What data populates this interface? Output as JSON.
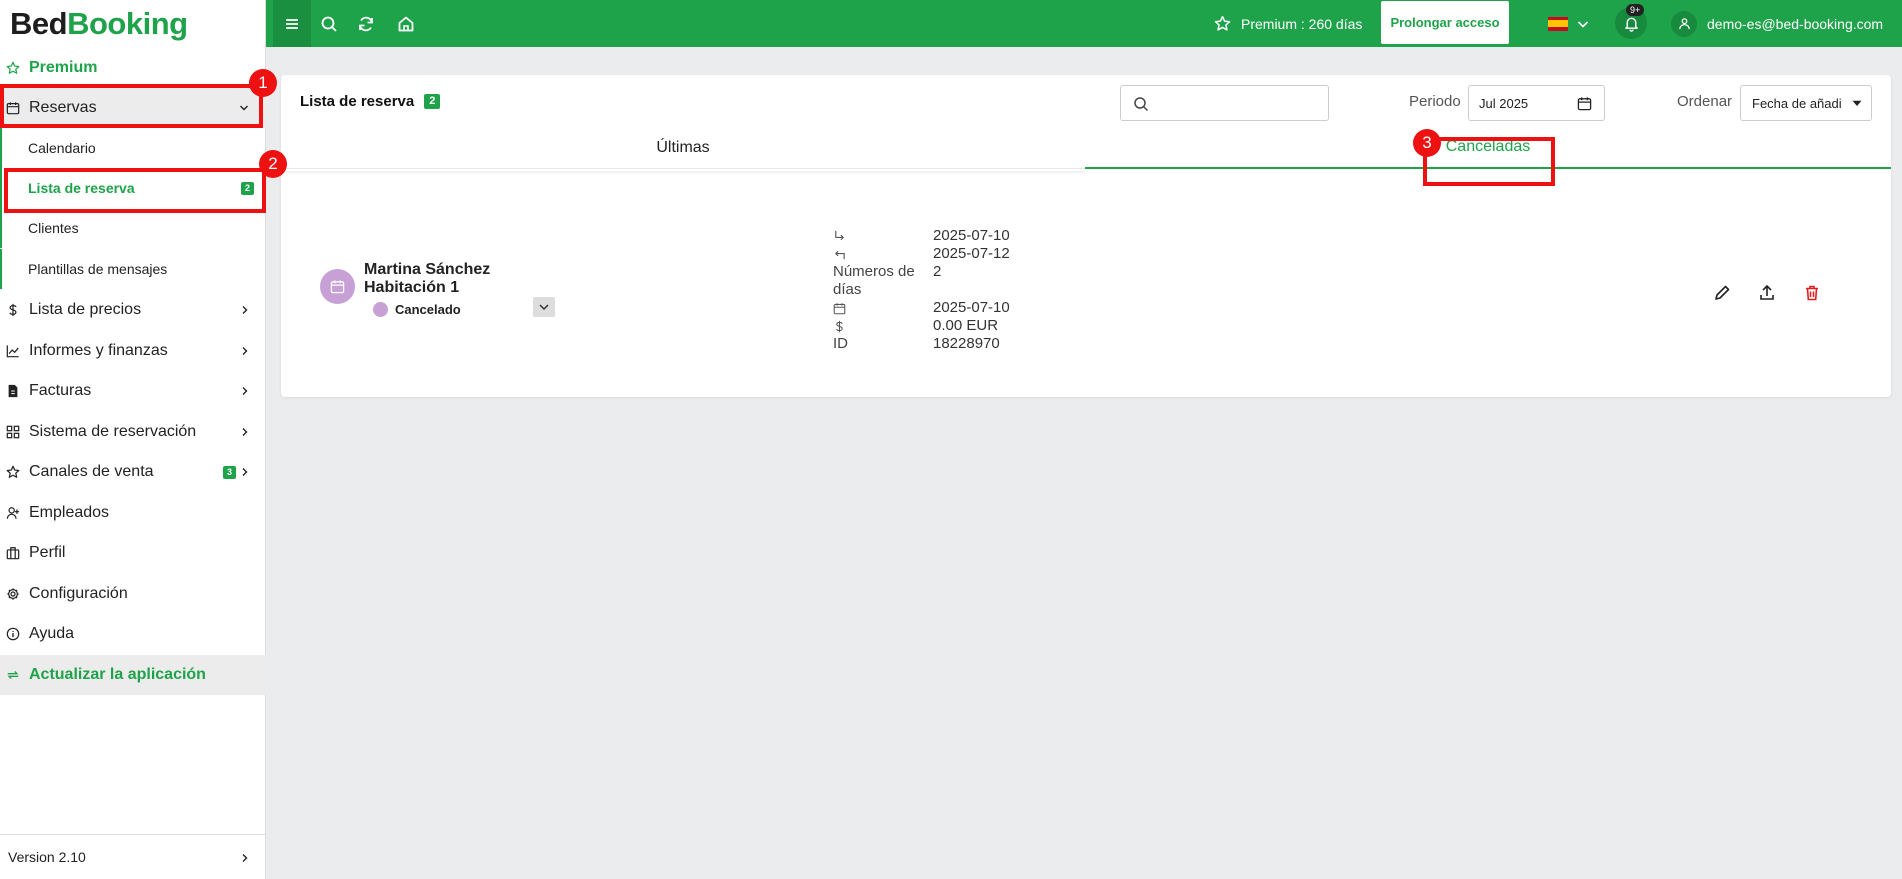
{
  "logo": {
    "part1": "Bed",
    "part2": "Booking"
  },
  "sidebar": {
    "premium": "Premium",
    "reservas": "Reservas",
    "sub_items": [
      "Calendario",
      "Lista de reserva",
      "Clientes",
      "Plantillas de mensajes"
    ],
    "lista_badge": "2",
    "items": [
      {
        "label": "Lista de precios",
        "icon": "dollar-icon"
      },
      {
        "label": "Informes y finanzas",
        "icon": "chart-icon"
      },
      {
        "label": "Facturas",
        "icon": "invoice-icon"
      },
      {
        "label": "Sistema de reservación",
        "icon": "grid-icon"
      },
      {
        "label": "Canales de venta",
        "icon": "star-icon",
        "badge": "3"
      },
      {
        "label": "Empleados",
        "icon": "user-add-icon"
      },
      {
        "label": "Perfil",
        "icon": "briefcase-icon"
      },
      {
        "label": "Configuración",
        "icon": "gear-icon"
      },
      {
        "label": "Ayuda",
        "icon": "info-icon"
      }
    ],
    "update": "Actualizar la aplicación",
    "version": "Version 2.10"
  },
  "annotations": [
    "1",
    "2",
    "3"
  ],
  "topbar": {
    "premium_text": "Premium : 260 días",
    "prolong_label": "Prolongar acceso",
    "notifications_badge": "9+",
    "user_email": "demo-es@bed-booking.com"
  },
  "main": {
    "title": "Lista de reserva",
    "count_badge": "2",
    "search_placeholder": "",
    "period_label": "Periodo",
    "period_value": "Jul 2025",
    "order_label": "Ordenar",
    "order_value": "Fecha de añadi",
    "tabs": [
      "Últimas",
      "Canceladas"
    ]
  },
  "reservation": {
    "guest": "Martina Sánchez",
    "room": "Habitación 1",
    "status": "Cancelado",
    "checkin": "2025-07-10",
    "checkout": "2025-07-12",
    "nights_label": "Números de días",
    "nights": "2",
    "created": "2025-07-10",
    "price": "0.00 EUR",
    "id_label": "ID",
    "id": "18228970"
  },
  "colors": {
    "brand": "#1fa34a",
    "annotation": "#ee1111",
    "cancelled": "#c7a1d6",
    "delete": "#e02020"
  }
}
